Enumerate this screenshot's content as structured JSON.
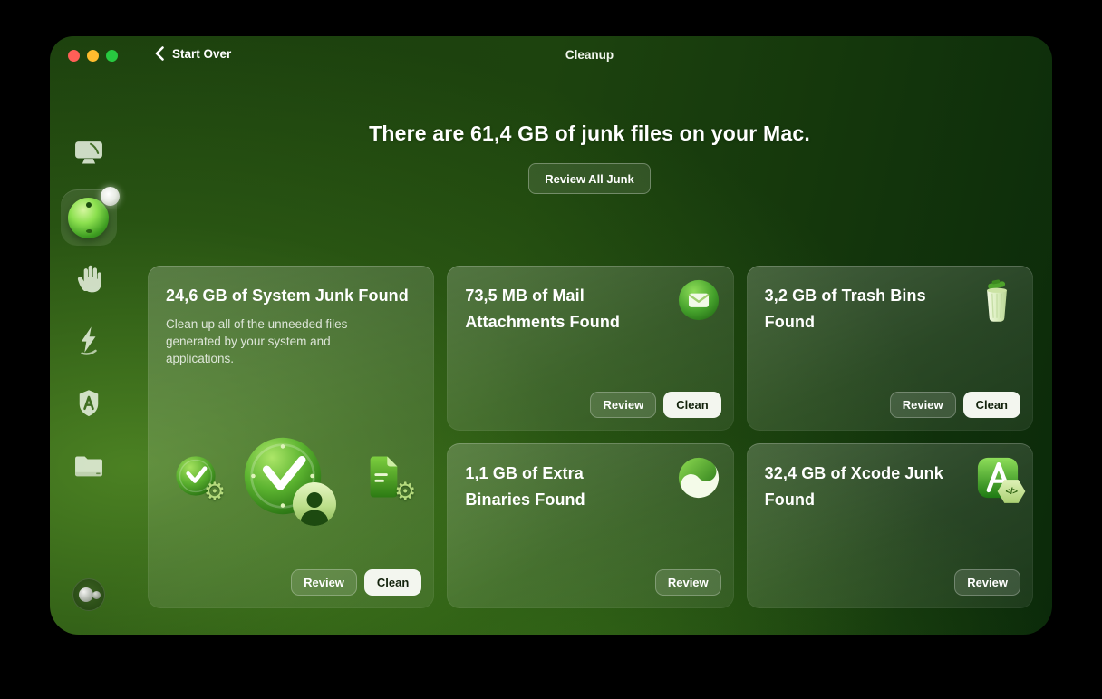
{
  "titlebar": {
    "back_label": "Start Over",
    "title": "Cleanup",
    "traffic_lights": {
      "close": "#ff5f57",
      "minimize": "#febc2e",
      "zoom": "#28c840"
    }
  },
  "hero": {
    "headline": "There are 61,4 GB of junk files on your Mac.",
    "review_all_label": "Review All Junk"
  },
  "sidebar": {
    "items": [
      {
        "icon": "smart-care-display-icon",
        "selected": false
      },
      {
        "icon": "cleanup-orb-icon",
        "selected": true,
        "badge": true
      },
      {
        "icon": "protection-hand-icon",
        "selected": false
      },
      {
        "icon": "performance-bolt-icon",
        "selected": false
      },
      {
        "icon": "applications-shield-icon",
        "selected": false
      },
      {
        "icon": "my-clutter-folder-icon",
        "selected": false
      }
    ],
    "footer_icon": "assistant-icon"
  },
  "cards": [
    {
      "title": "24,6 GB of System Junk Found",
      "description": "Clean up all of the unneeded files generated by your system and applications.",
      "icons": [
        "clock-gear-icon",
        "clock-user-icon",
        "document-gear-icon"
      ],
      "review_label": "Review",
      "clean_label": "Clean"
    },
    {
      "title": "73,5 MB of Mail Attachments Found",
      "icon": "mail-icon",
      "review_label": "Review",
      "clean_label": "Clean"
    },
    {
      "title": "3,2 GB of Trash Bins Found",
      "icon": "trash-icon",
      "review_label": "Review",
      "clean_label": "Clean"
    },
    {
      "title": "1,1 GB of Extra Binaries Found",
      "icon": "binaries-icon",
      "review_label": "Review"
    },
    {
      "title": "32,4 GB of Xcode Junk Found",
      "icon": "xcode-icon",
      "badge_text": "</>",
      "review_label": "Review"
    }
  ],
  "colors": {
    "window_bg_dark": "#0b2a0a",
    "window_bg_light": "#3c6c20",
    "clean_button_bg": "#f3f6ef",
    "accent_green": "#3f9e22"
  }
}
